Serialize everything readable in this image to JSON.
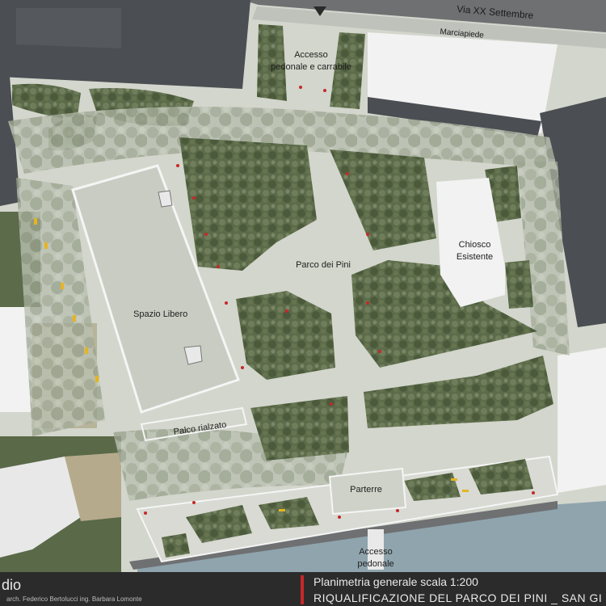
{
  "map": {
    "labels": {
      "street": "Via XX Settembre",
      "sidewalk": "Marciapiede",
      "access_top_line1": "Accesso",
      "access_top_line2": "pedonale e carrabile",
      "park": "Parco dei Pini",
      "kiosk_line1": "Chiosco",
      "kiosk_line2": "Esistente",
      "free_space": "Spazio Libero",
      "stage": "Palco rialzato",
      "parterre": "Parterre",
      "access_bottom_line1": "Accesso",
      "access_bottom_line2": "pedonale"
    },
    "colors": {
      "paving": "#d3d6cc",
      "lawn": "#5c6b4a",
      "building": "#4b4e52",
      "building_light": "#f2f2f2",
      "road": "#6e7072",
      "water": "#8fa4ad",
      "accent_red": "#c62828",
      "lamp_yellow": "#e6b422"
    }
  },
  "footer": {
    "studio": "dio",
    "authors": "arch. Federico Bertolucci   ing. Barbara Lomonte",
    "title": "Planimetria generale scala 1:200",
    "subtitle": "RIQUALIFICAZIONE DEL PARCO DEI PINI _ SAN GI"
  }
}
